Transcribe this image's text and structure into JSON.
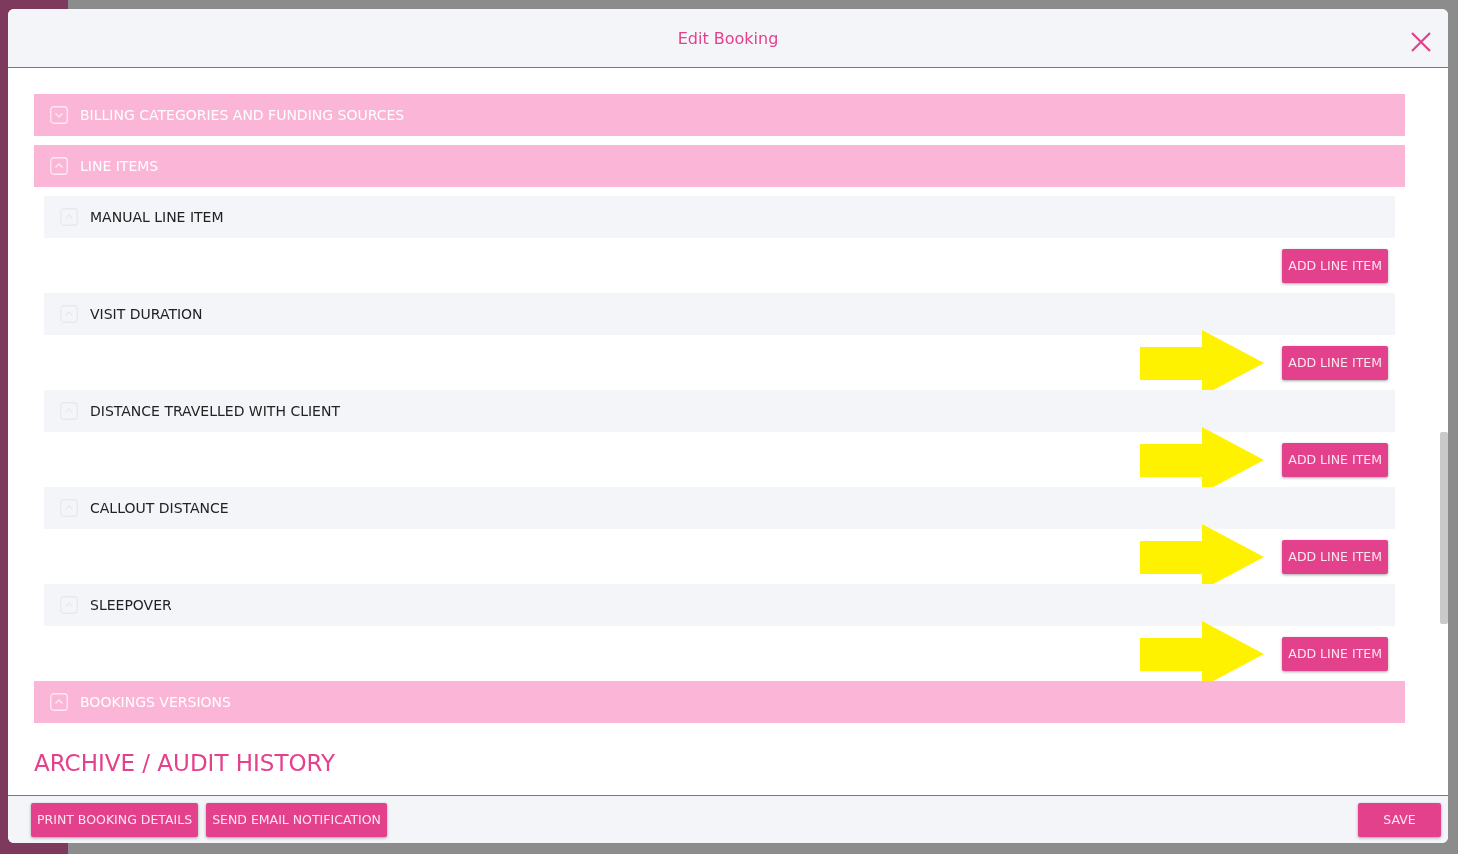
{
  "dialog": {
    "title": "Edit Booking"
  },
  "sections": [
    {
      "title": "BILLING CATEGORIES AND FUNDING SOURCES",
      "expanded": false
    },
    {
      "title": "LINE ITEMS",
      "expanded": true,
      "line_items": [
        {
          "label": "MANUAL LINE ITEM",
          "button": "ADD LINE ITEM",
          "highlighted": false
        },
        {
          "label": "VISIT DURATION",
          "button": "ADD LINE ITEM",
          "highlighted": true
        },
        {
          "label": "DISTANCE TRAVELLED WITH CLIENT",
          "button": "ADD LINE ITEM",
          "highlighted": true
        },
        {
          "label": "CALLOUT DISTANCE",
          "button": "ADD LINE ITEM",
          "highlighted": true
        },
        {
          "label": "SLEEPOVER",
          "button": "ADD LINE ITEM",
          "highlighted": true
        }
      ]
    },
    {
      "title": "BOOKINGS VERSIONS",
      "expanded": true
    }
  ],
  "archive_heading": "ARCHIVE / AUDIT HISTORY",
  "footer": {
    "left_buttons": [
      "PRINT BOOKING DETAILS",
      "SEND EMAIL NOTIFICATION"
    ],
    "right_buttons": [
      "SAVE"
    ]
  }
}
